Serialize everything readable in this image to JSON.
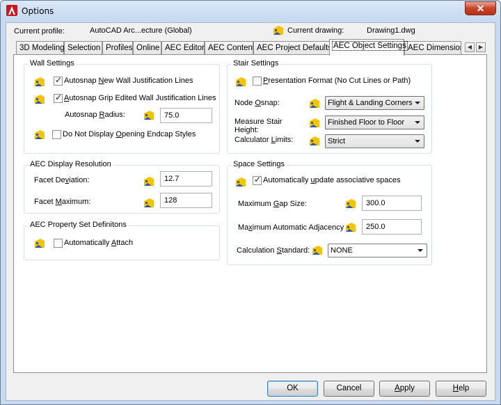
{
  "window": {
    "title": "Options",
    "close_glyph": "✕"
  },
  "profile": {
    "label": "Current profile:",
    "value": "AutoCAD Arc...ecture (Global)"
  },
  "drawing": {
    "label": "Current drawing:",
    "value": "Drawing1.dwg",
    "icon": "drawing-icon"
  },
  "tabs": [
    "3D Modeling",
    "Selection",
    "Profiles",
    "Online",
    "AEC Editor",
    "AEC Content",
    "AEC Project Defaults",
    "AEC Object Settings",
    "AEC Dimension"
  ],
  "active_tab": "AEC Object Settings",
  "wall": {
    "title": "Wall Settings",
    "new_wall_pre": "Autosnap ",
    "new_wall_u": "N",
    "new_wall_post": "ew Wall Justification Lines",
    "new_wall_checked": true,
    "grip_pre": "",
    "grip_u": "A",
    "grip_post": "utosnap Grip Edited Wall Justification Lines",
    "grip_checked": true,
    "radius_pre": "Autosnap ",
    "radius_u": "R",
    "radius_post": "adius:",
    "radius_value": "75.0",
    "endcap_pre": "Do Not Display ",
    "endcap_u": "O",
    "endcap_post": "pening Endcap Styles",
    "endcap_checked": false
  },
  "display": {
    "title": "AEC Display Resolution",
    "facet_dev_pre": "Facet De",
    "facet_dev_u": "v",
    "facet_dev_post": "iation:",
    "facet_dev_value": "12.7",
    "facet_max_pre": "Facet ",
    "facet_max_u": "M",
    "facet_max_post": "aximum:",
    "facet_max_value": "128"
  },
  "propset": {
    "title": "AEC Property Set Definitons",
    "attach_pre": "Automatically ",
    "attach_u": "A",
    "attach_post": "ttach",
    "attach_checked": false
  },
  "stair": {
    "title": "Stair Settings",
    "pres_pre": "",
    "pres_u": "P",
    "pres_post": "resentation Format (No Cut Lines or Path)",
    "pres_checked": false,
    "node_pre": "Node ",
    "node_u": "O",
    "node_post": "snap:",
    "node_value": "Flight & Landing Corners",
    "measure_line1": "Measure Stair",
    "measure_line2": "Height:",
    "measure_value": "Finished Floor to Floor",
    "calc_pre": "Calculator ",
    "calc_u": "L",
    "calc_post": "imits:",
    "calc_value": "Strict"
  },
  "space": {
    "title": "Space Settings",
    "update_pre": "Automatically ",
    "update_u": "u",
    "update_post": "pdate associative spaces",
    "update_checked": true,
    "gap_pre": "Maximum ",
    "gap_u": "G",
    "gap_post": "ap Size:",
    "gap_value": "300.0",
    "adj_pre": "Ma",
    "adj_u": "x",
    "adj_post": "imum Automatic Adjacency",
    "adj_value": "250.0",
    "calc_pre": "Calculation ",
    "calc_u": "S",
    "calc_post": "tandard:",
    "calc_value": "NONE"
  },
  "buttons": {
    "ok": "OK",
    "cancel": "Cancel",
    "apply_u": "A",
    "apply_post": "pply",
    "help_u": "H",
    "help_post": "elp"
  },
  "colors": {
    "titlebar": "#c5d8ef",
    "close": "#c7432a",
    "icon_yellow": "#f4c400",
    "icon_blue": "#2a5ba8"
  }
}
